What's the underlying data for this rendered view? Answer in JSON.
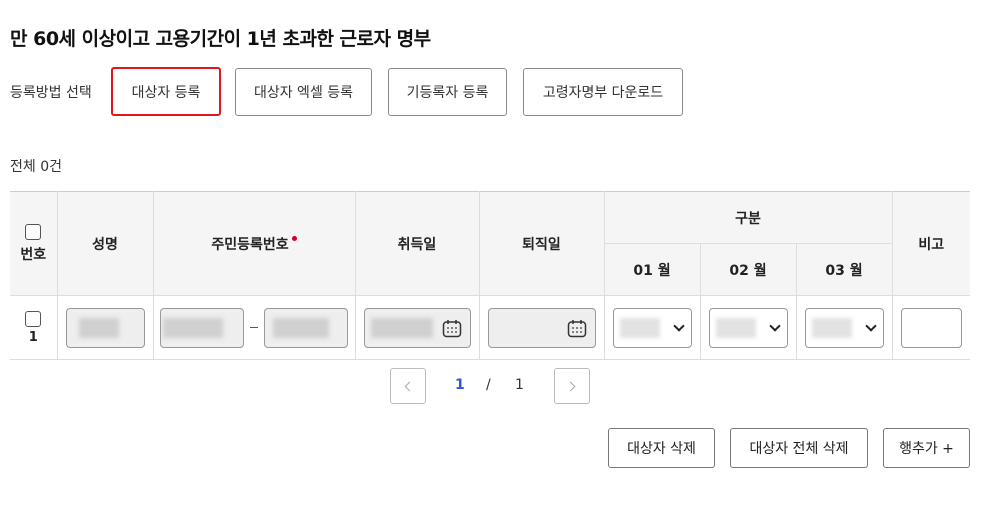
{
  "page": {
    "title": "만 60세 이상이고 고용기간이 1년 초과한 근로자 명부"
  },
  "register": {
    "label": "등록방법 선택",
    "buttons": {
      "target": "대상자 등록",
      "excel": "대상자 엑셀 등록",
      "existing": "기등록자 등록",
      "download": "고령자명부 다운로드"
    }
  },
  "summary": {
    "total": "전체 0건"
  },
  "table": {
    "headers": {
      "number": "번호",
      "name": "성명",
      "rrn": "주민등록번호",
      "acquire": "취득일",
      "leave": "퇴직일",
      "category": "구분",
      "month1": "01 월",
      "month2": "02 월",
      "month3": "03 월",
      "note": "비고"
    },
    "rows": [
      {
        "number": "1"
      }
    ]
  },
  "pagination": {
    "current": "1",
    "separator": "/",
    "total": "1"
  },
  "actions": {
    "delete": "대상자 삭제",
    "delete_all": "대상자 전체 삭제",
    "add_row": "행추가 +"
  },
  "colors": {
    "accent_border": "#e3151d",
    "required_dot": "#d6002a",
    "page_current": "#2f55d4"
  }
}
